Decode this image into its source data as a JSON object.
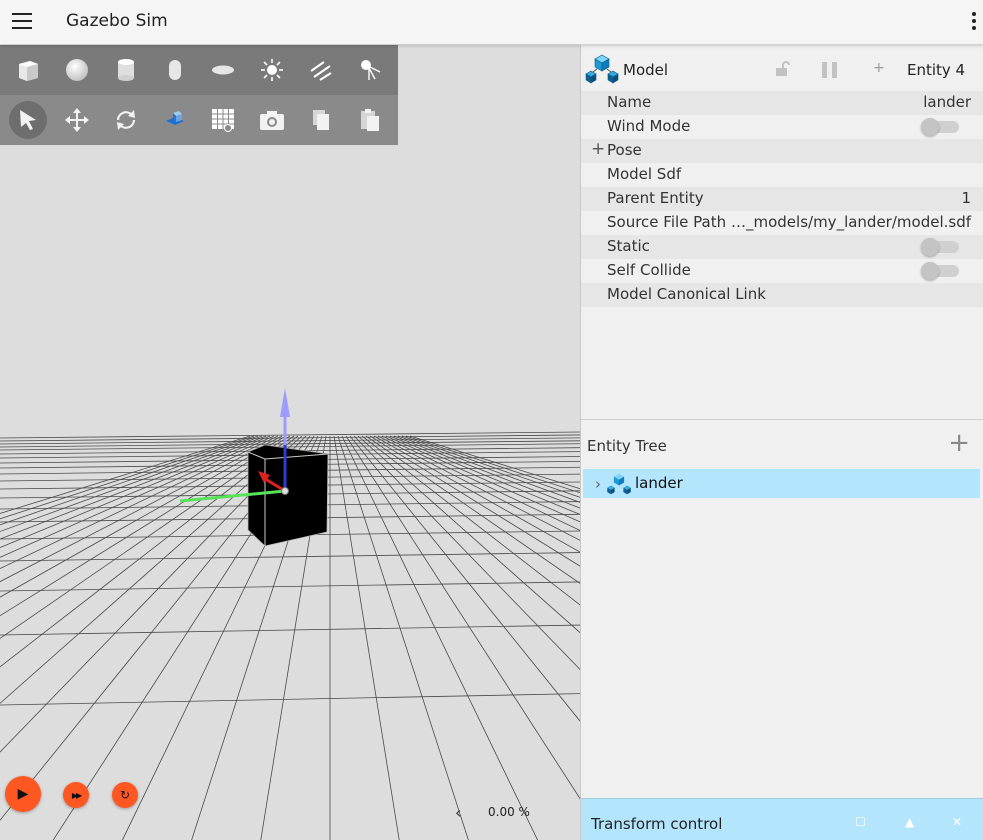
{
  "app": {
    "title": "Gazebo Sim"
  },
  "toolbar_shapes": [
    "box-shape-icon",
    "sphere-shape-icon",
    "cylinder-shape-icon",
    "capsule-shape-icon",
    "ellipsoid-shape-icon",
    "point-light-icon",
    "directional-light-icon",
    "spot-light-icon"
  ],
  "toolbar_tools": [
    "select-arrow-icon",
    "translate-icon",
    "rotate-icon",
    "view-angle-icon",
    "grid-snap-icon",
    "screenshot-camera-icon",
    "copy-icon",
    "paste-icon"
  ],
  "inspector": {
    "type": "Model",
    "entity": "Entity 4",
    "name_label": "Name",
    "name_value": "lander",
    "wind_label": "Wind Mode",
    "pose_label": "Pose",
    "sdf_label": "Model Sdf",
    "parent_label": "Parent Entity",
    "parent_value": "1",
    "source_label": "Source File Path",
    "source_value": "…_models/my_lander/model.sdf",
    "static_label": "Static",
    "self_collide_label": "Self Collide",
    "canonical_label": "Model Canonical Link",
    "plus_glyph": "+",
    "small_plus": "+"
  },
  "entity_tree": {
    "title": "Entity Tree",
    "add_glyph": "+",
    "chevron": "›",
    "item": "lander"
  },
  "transform": {
    "title": "Transform control",
    "btn1": "☐",
    "btn2": "▲",
    "btn3": "✕"
  },
  "playback": {
    "play": "▶",
    "step": "▶▶",
    "reset": "↻",
    "chevron": "‹",
    "rtf": "0.00 %"
  },
  "colors": {
    "accent": "#ff5722",
    "selection": "#b3e5fc",
    "toolbar": "#7a7a7a"
  }
}
